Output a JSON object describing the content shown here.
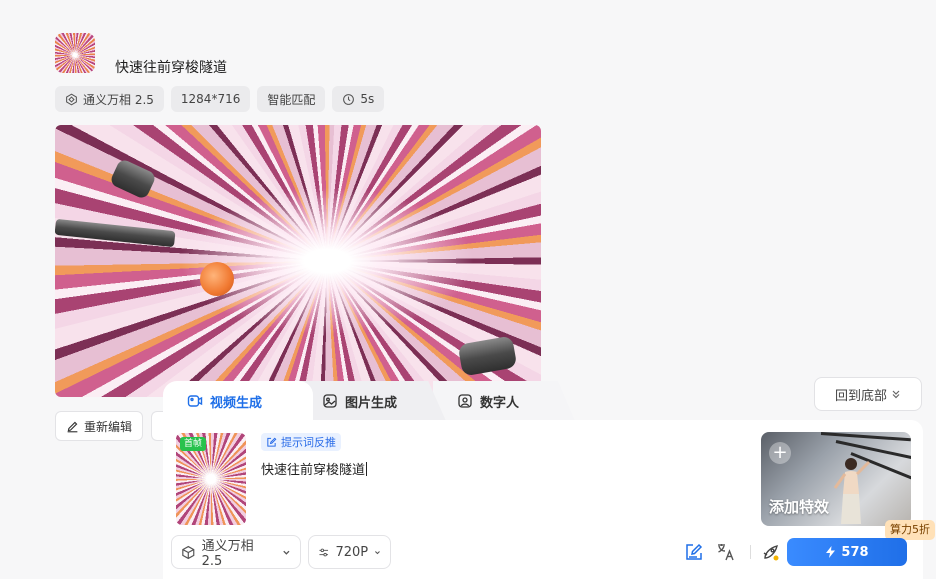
{
  "header": {
    "title": "快速往前穿梭隧道",
    "tags": [
      "通义万相 2.5",
      "1284*716",
      "智能匹配",
      "5s"
    ]
  },
  "actions": {
    "edit_label": "重新编辑",
    "back_to_bottom_label": "回到底部"
  },
  "composer": {
    "tabs": [
      {
        "label": "视频生成",
        "icon": "video-icon",
        "active": true
      },
      {
        "label": "图片生成",
        "icon": "image-icon",
        "active": false
      },
      {
        "label": "数字人",
        "icon": "digital-human-icon",
        "active": false
      }
    ],
    "first_frame_badge": "首帧",
    "hint_tag": "提示词反推",
    "prompt_value": "快速往前穿梭隧道",
    "effect_card_label": "添加特效",
    "discount_badge": "算力5折",
    "model_select": "通义万相 2.5",
    "resolution_select": "720P",
    "generate_cost": "578"
  },
  "colors": {
    "accent": "#1f6fe8",
    "badge_green": "#27c24c",
    "discount_bg": "#ffe1b8"
  }
}
